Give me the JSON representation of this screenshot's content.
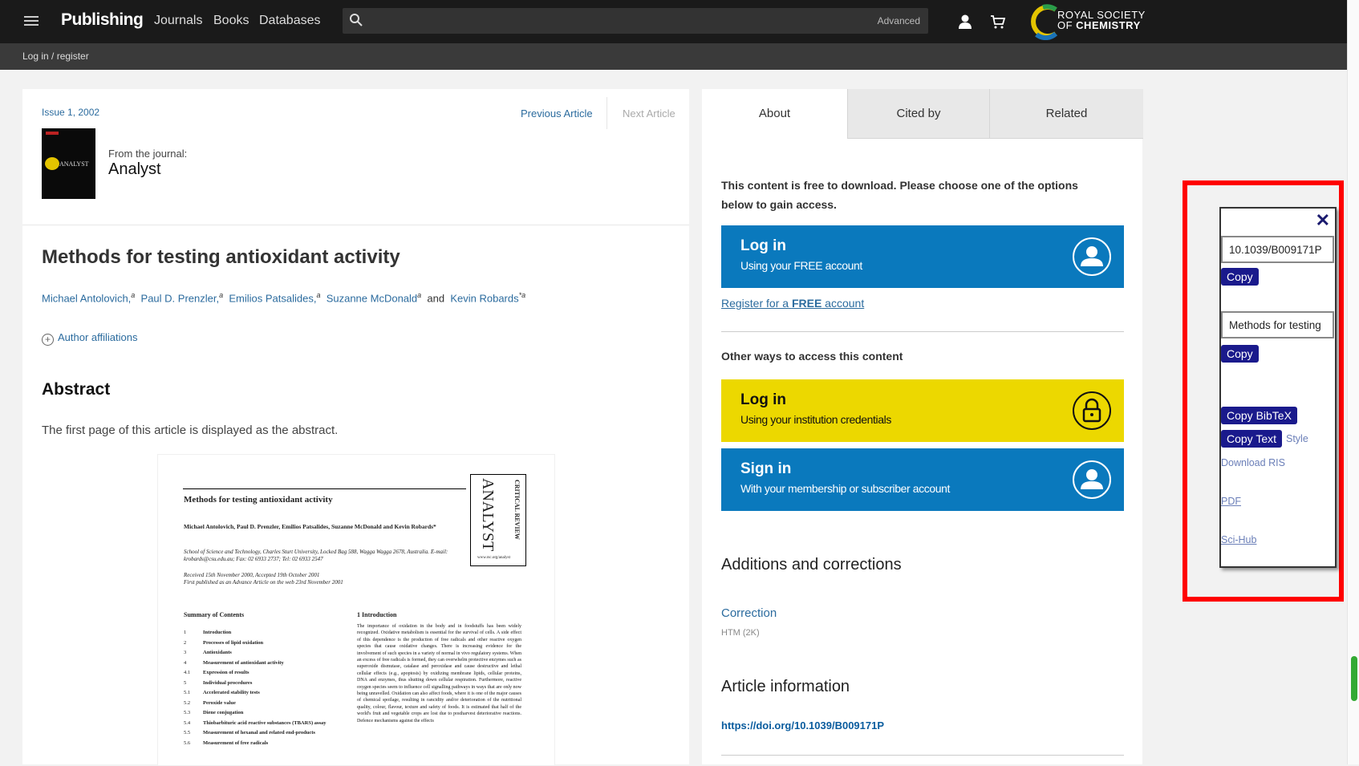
{
  "header": {
    "brand": "Publishing",
    "nav": [
      "Journals",
      "Books",
      "Databases"
    ],
    "search_placeholder": "",
    "advanced": "Advanced",
    "org_line1": "ROYAL SOCIETY",
    "org_line2_a": "OF ",
    "org_line2_b": "CHEMISTRY"
  },
  "subbar": {
    "login": "Log in / register"
  },
  "article": {
    "issue": "Issue 1, 2002",
    "prev": "Previous Article",
    "next": "Next Article",
    "cover_text": "ANALYST",
    "from_journal": "From the journal:",
    "journal": "Analyst",
    "title": "Methods for testing antioxidant activity",
    "authors": [
      "Michael Antolovich,",
      "Paul D. Prenzler,",
      "Emilios Patsalides,",
      "Suzanne McDonald",
      "Kevin Robards"
    ],
    "author_sup": [
      "a",
      "a",
      "a",
      "a",
      "*a"
    ],
    "and": "and",
    "affiliations": "Author affiliations",
    "abstract_heading": "Abstract",
    "abstract_text": "The first page of this article is displayed as the abstract."
  },
  "preview": {
    "title": "Methods for testing antioxidant activity",
    "box_the": "THE",
    "box_big": "ANALYST",
    "box_crit": "CRITICAL REVIEW",
    "box_url": "www.rsc.org/analyst",
    "authors": "Michael Antolovich, Paul D. Prenzler, Emilios Patsalides, Suzanne McDonald and Kevin Robards*",
    "address": "School of Science and Technology, Charles Sturt University, Locked Bag 588, Wagga Wagga 2678, Australia. E-mail: krobards@csu.edu.au; Fax: 02 6933 2737; Tel: 02 6933 2547",
    "received": "Received 15th November 2000, Accepted 19th October 2001",
    "published": "First published as an Advance Article on the web 23rd November 2001",
    "summary": "Summary of Contents",
    "toc": [
      [
        "1",
        "Introduction"
      ],
      [
        "2",
        "Processes of lipid oxidation"
      ],
      [
        "3",
        "Antioxidants"
      ],
      [
        "4",
        "Measurement of antioxidant activity"
      ],
      [
        "4.1",
        "Expression of results"
      ],
      [
        "5",
        "Individual procedures"
      ],
      [
        "5.1",
        "Accelerated stability tests"
      ],
      [
        "5.2",
        "Peroxide value"
      ],
      [
        "5.3",
        "Diene conjugation"
      ],
      [
        "5.4",
        "Thiobarbituric acid reactive substances (TBARS) assay"
      ],
      [
        "5.5",
        "Measurement of hexanal and related end-products"
      ],
      [
        "5.6",
        "Measurement of free radicals"
      ]
    ],
    "intro_heading": "1 Introduction",
    "intro_text": "The importance of oxidation in the body and in foodstuffs has been widely recognized. Oxidative metabolism is essential for the survival of cells. A side effect of this dependence is the production of free radicals and other reactive oxygen species that cause oxidative changes. There is increasing evidence for the involvement of such species in a variety of normal in vivo regulatory systems. When an excess of free radicals is formed, they can overwhelm protective enzymes such as superoxide dismutase, catalase and peroxidase and cause destructive and lethal cellular effects (e.g., apoptosis) by oxidizing membrane lipids, cellular proteins, DNA and enzymes, thus shutting down cellular respiration. Furthermore, reactive oxygen species seem to influence cell signalling pathways in ways that are only now being unravelled. Oxidation can also affect foods, where it is one of the major causes of chemical spoilage, resulting in rancidity and/or deterioration of the nutritional quality, colour, flavour, texture and safety of foods. It is estimated that half of the world's fruit and vegetable crops are lost due to postharvest deteriorative reactions. Defence mechanisms against the effects"
  },
  "side": {
    "tabs": [
      "About",
      "Cited by",
      "Related"
    ],
    "free_text": "This content is free to download. Please choose one of the options below to gain access.",
    "login_title": "Log in",
    "login_sub": "Using your FREE account",
    "register_a": "Register for a ",
    "register_b": "FREE",
    "register_c": " account",
    "other_ways": "Other ways to access this content",
    "inst_title": "Log in",
    "inst_sub": "Using your institution credentials",
    "sign_title": "Sign in",
    "sign_sub": "With your membership or subscriber account",
    "additions": "Additions and corrections",
    "correction": "Correction",
    "htm": "HTM (2K)",
    "article_info": "Article information",
    "doi": "https://doi.org/10.1039/B009171P"
  },
  "popup": {
    "close": "✕",
    "doi_value": "10.1039/B009171P",
    "copy1": "Copy",
    "title_value": "Methods for testing",
    "copy2": "Copy",
    "copy_bibtex": "Copy BibTeX",
    "copy_text": "Copy Text",
    "style": "Style",
    "download_ris": "Download RIS",
    "pdf": "PDF",
    "scihub": "Sci-Hub"
  },
  "colors": {
    "topbar": "#1a1a1a",
    "blue_btn": "#0a79bd",
    "yellow_btn": "#ecd800",
    "popup_btn": "#1a1a8c",
    "highlight": "#ff0000"
  },
  "icons": [
    "menu-icon",
    "search-icon",
    "user-icon",
    "cart-icon",
    "person-circle-icon",
    "lock-icon",
    "close-icon",
    "plus-circle-icon"
  ]
}
